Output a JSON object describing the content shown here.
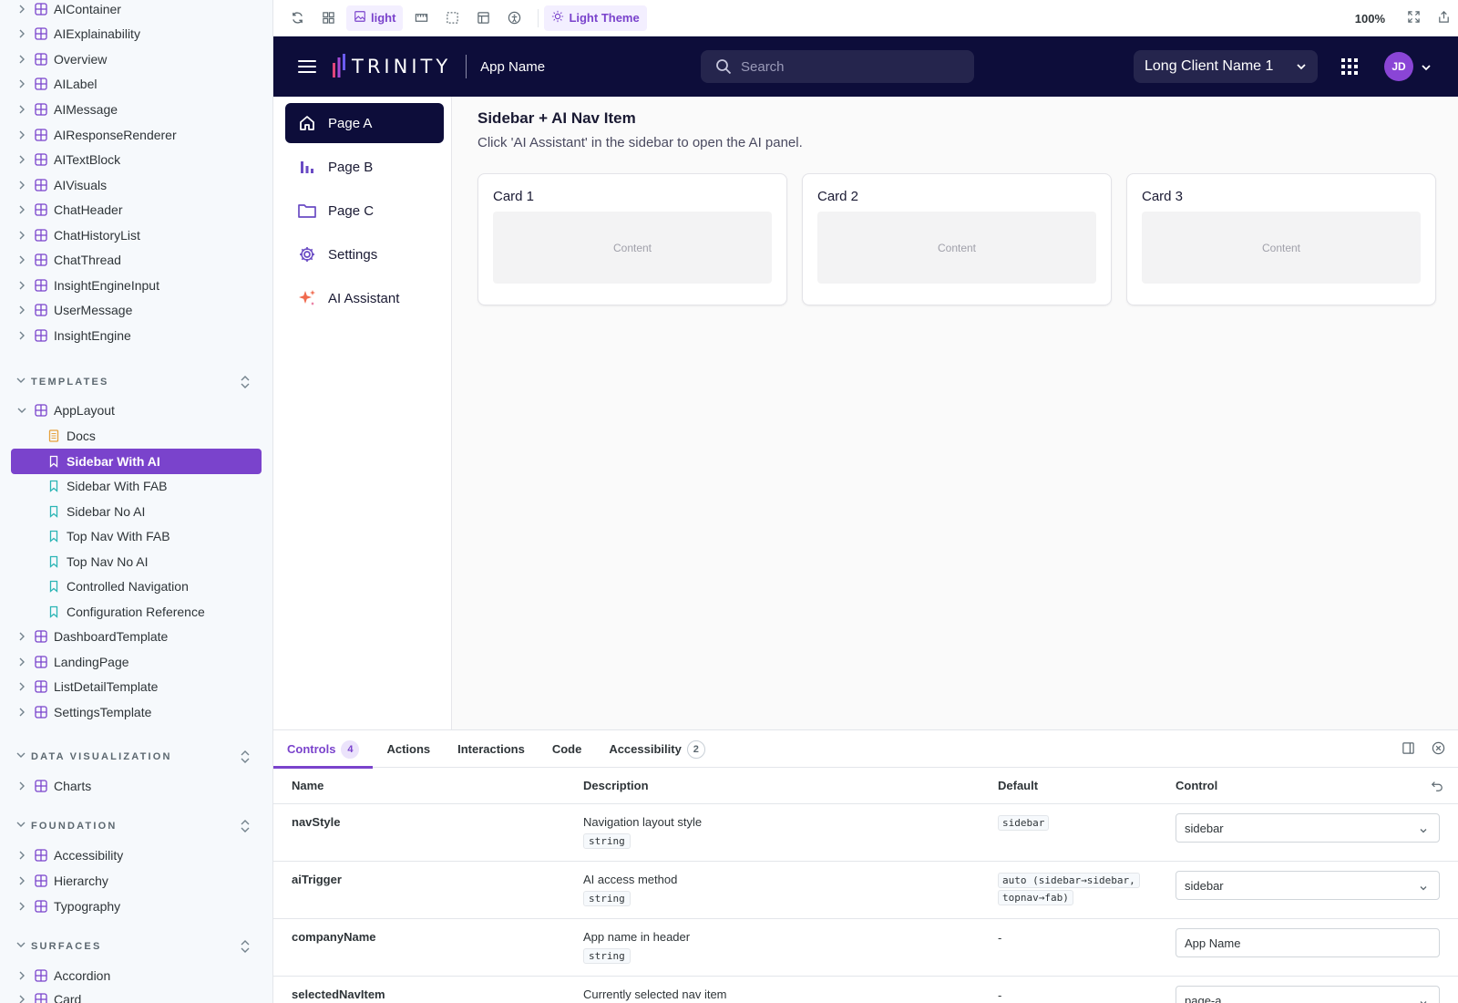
{
  "sidebar": {
    "top_items": [
      "AIContainer",
      "AIExplainability",
      "Overview",
      "AILabel",
      "AIMessage",
      "AIResponseRenderer",
      "AITextBlock",
      "AIVisuals",
      "ChatHeader",
      "ChatHistoryList",
      "ChatThread",
      "InsightEngineInput",
      "UserMessage",
      "InsightEngine"
    ],
    "templates": {
      "heading": "TEMPLATES",
      "component": "AppLayout",
      "stories": [
        "Docs",
        "Sidebar With AI",
        "Sidebar With FAB",
        "Sidebar No AI",
        "Top Nav With FAB",
        "Top Nav No AI",
        "Controlled Navigation",
        "Configuration Reference"
      ],
      "others": [
        "DashboardTemplate",
        "LandingPage",
        "ListDetailTemplate",
        "SettingsTemplate"
      ]
    },
    "data_viz": {
      "heading": "DATA VISUALIZATION",
      "items": [
        "Charts"
      ]
    },
    "foundation": {
      "heading": "FOUNDATION",
      "items": [
        "Accessibility",
        "Hierarchy",
        "Typography"
      ]
    },
    "surfaces": {
      "heading": "SURFACES",
      "items": [
        "Accordion",
        "Card"
      ]
    }
  },
  "toolbar": {
    "background_label": "light",
    "theme_label": "Light Theme",
    "zoom": "100%"
  },
  "app": {
    "logo_text": "TRINITY",
    "app_name": "App Name",
    "search_placeholder": "Search",
    "client": "Long Client Name 1",
    "avatar_initials": "JD",
    "nav": [
      {
        "label": "Page A",
        "icon": "home-icon"
      },
      {
        "label": "Page B",
        "icon": "bar-chart-icon"
      },
      {
        "label": "Page C",
        "icon": "folder-icon"
      },
      {
        "label": "Settings",
        "icon": "gear-icon"
      },
      {
        "label": "AI Assistant",
        "icon": "sparkle-icon"
      }
    ],
    "title": "Sidebar + AI Nav Item",
    "subtitle": "Click 'AI Assistant' in the sidebar to open the AI panel.",
    "cards": [
      {
        "title": "Card 1",
        "content": "Content"
      },
      {
        "title": "Card 2",
        "content": "Content"
      },
      {
        "title": "Card 3",
        "content": "Content"
      }
    ]
  },
  "panel": {
    "tabs": [
      {
        "label": "Controls",
        "badge": "4"
      },
      {
        "label": "Actions",
        "badge": ""
      },
      {
        "label": "Interactions",
        "badge": ""
      },
      {
        "label": "Code",
        "badge": ""
      },
      {
        "label": "Accessibility",
        "badge": "2"
      }
    ],
    "headers": {
      "name": "Name",
      "description": "Description",
      "default": "Default",
      "control": "Control"
    },
    "rows": [
      {
        "name": "navStyle",
        "description": "Navigation layout style",
        "type": "string",
        "default_line1": "sidebar",
        "default_line2": "",
        "control": "sidebar"
      },
      {
        "name": "aiTrigger",
        "description": "AI access method",
        "type": "string",
        "default_line1": "auto (sidebar→sidebar,",
        "default_line2": "topnav→fab)",
        "control": "sidebar"
      },
      {
        "name": "companyName",
        "description": "App name in header",
        "type": "string",
        "default_line1": "-",
        "default_line2": "",
        "control": "App Name"
      },
      {
        "name": "selectedNavItem",
        "description": "Currently selected nav item",
        "type": "",
        "default_line1": "-",
        "default_line2": "",
        "control": "page-a"
      }
    ]
  }
}
